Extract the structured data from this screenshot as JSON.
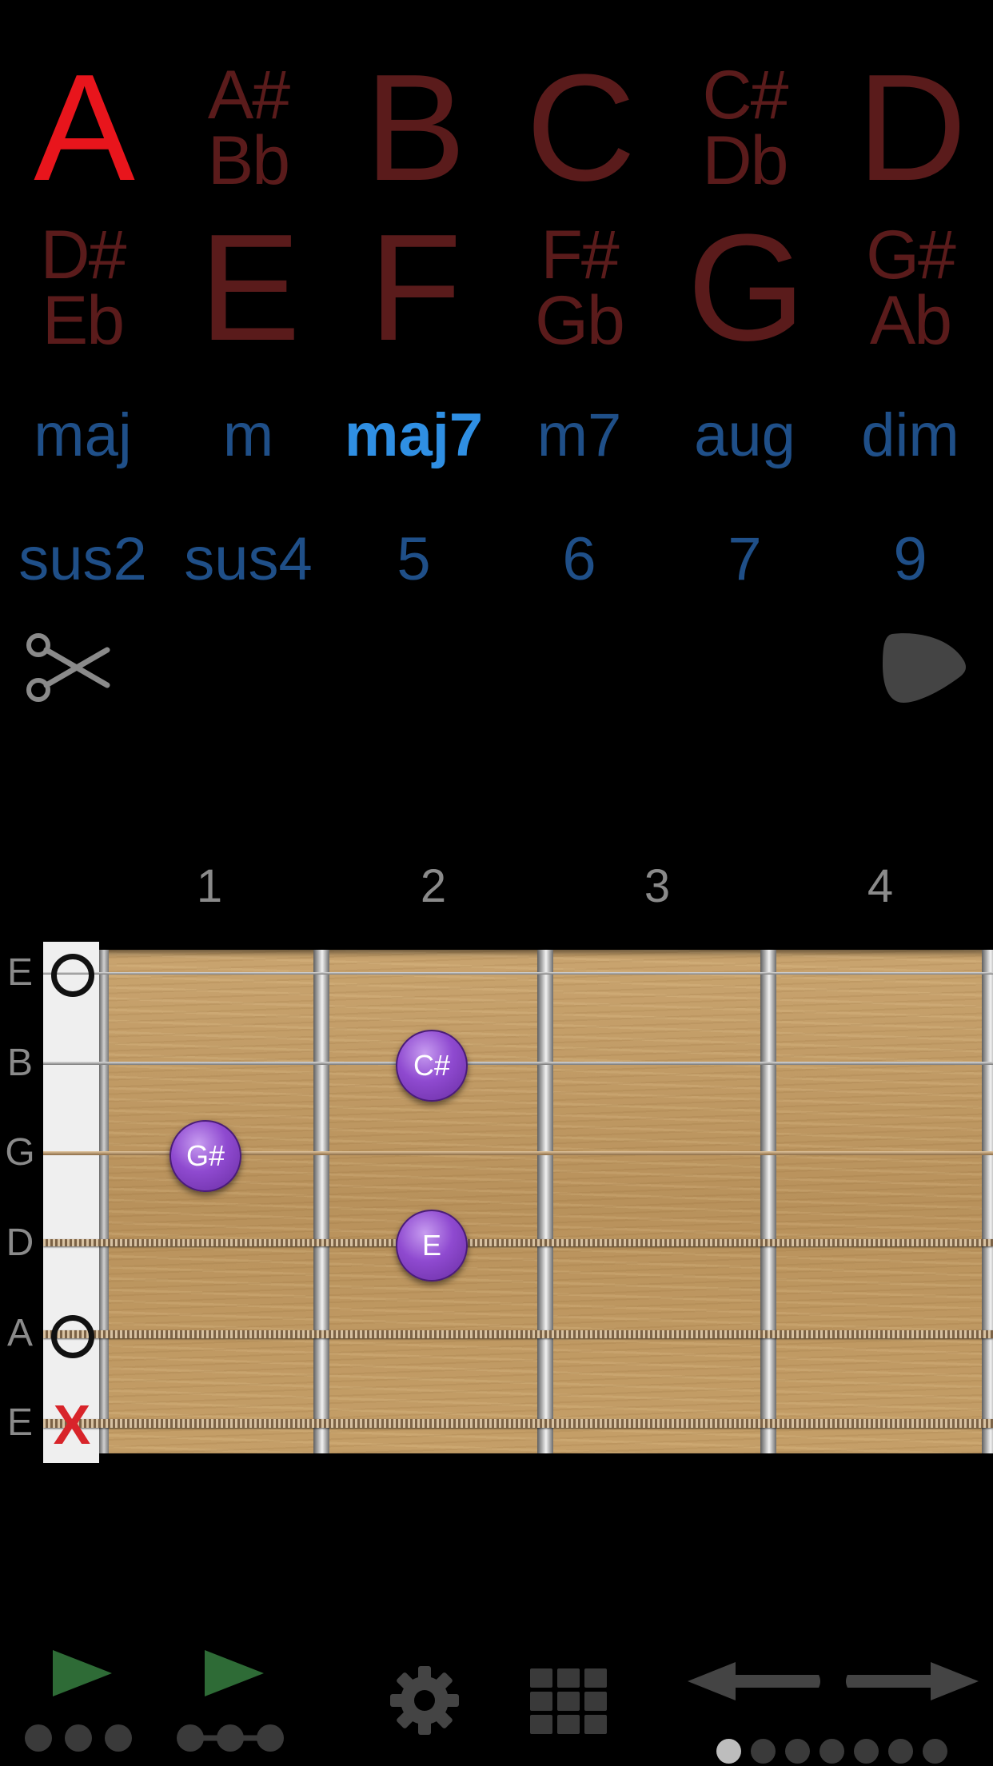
{
  "roots": [
    {
      "id": "A",
      "lines": [
        "A"
      ],
      "active": true
    },
    {
      "id": "A#",
      "lines": [
        "A#",
        "Bb"
      ]
    },
    {
      "id": "B",
      "lines": [
        "B"
      ]
    },
    {
      "id": "C",
      "lines": [
        "C"
      ]
    },
    {
      "id": "C#",
      "lines": [
        "C#",
        "Db"
      ]
    },
    {
      "id": "D",
      "lines": [
        "D"
      ]
    },
    {
      "id": "D#",
      "lines": [
        "D#",
        "Eb"
      ]
    },
    {
      "id": "E",
      "lines": [
        "E"
      ]
    },
    {
      "id": "F",
      "lines": [
        "F"
      ]
    },
    {
      "id": "F#",
      "lines": [
        "F#",
        "Gb"
      ]
    },
    {
      "id": "G",
      "lines": [
        "G"
      ]
    },
    {
      "id": "G#",
      "lines": [
        "G#",
        "Ab"
      ]
    }
  ],
  "chord_types_row1": [
    "maj",
    "m",
    "maj7",
    "m7",
    "aug",
    "dim"
  ],
  "chord_types_row2": [
    "sus2",
    "sus4",
    "5",
    "6",
    "7",
    "9"
  ],
  "selected_type": "maj7",
  "fret_numbers": [
    "1",
    "2",
    "3",
    "4"
  ],
  "string_names": [
    "E",
    "B",
    "G",
    "D",
    "A",
    "E"
  ],
  "open_strings": [
    "E-high",
    "A"
  ],
  "muted_strings": [
    "E-low"
  ],
  "fingering": [
    {
      "string": "B",
      "fret": 2,
      "note": "C#"
    },
    {
      "string": "G",
      "fret": 1,
      "note": "G#"
    },
    {
      "string": "D",
      "fret": 2,
      "note": "E"
    }
  ],
  "mute_symbol": "X",
  "colors": {
    "root_active": "#e8151c",
    "root_inactive": "#5a1b1b",
    "type_active": "#2f8fe3",
    "type_inactive": "#1f4f88",
    "dot": "#8f4ad0",
    "play": "#2e6b36"
  },
  "icons": {
    "tools": [
      "scissors-icon",
      "guitar-pick-icon"
    ],
    "bottom": [
      "play-strum-icon",
      "play-arpeggio-icon",
      "gear-icon",
      "grid-icon",
      "arrow-left-icon",
      "arrow-right-icon"
    ]
  },
  "page_indicator": {
    "total": 7,
    "current": 1
  }
}
